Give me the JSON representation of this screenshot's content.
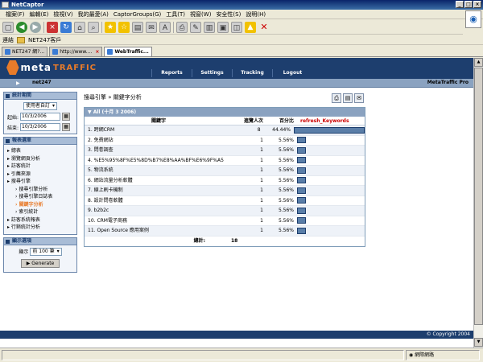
{
  "window": {
    "title": "NetCaptor"
  },
  "menubar": [
    "檔案(F)",
    "編輯(E)",
    "檢視(V)",
    "我的最愛(A)",
    "CaptorGroups(G)",
    "工具(T)",
    "視窗(W)",
    "安全性(S)",
    "說明(H)"
  ],
  "links": {
    "label": "連結",
    "folder": "NET247客戶"
  },
  "tabs": [
    {
      "label": "NET247 網?..."
    },
    {
      "label": "http://www...."
    },
    {
      "label": "WebTraffic..."
    }
  ],
  "app": {
    "logo_word1": "meta",
    "logo_word2": "TRAFFIC",
    "nav": [
      "Reports",
      "Settings",
      "Tracking",
      "Logout"
    ],
    "user": "net247",
    "product": "MetaTraffic Pro",
    "copyright": "© Copyright 2004"
  },
  "sidebar": {
    "date_section": "統計期間",
    "range_select": "使用者自訂",
    "start_label": "起始:",
    "start_value": "10/3/2006",
    "end_label": "結束:",
    "end_value": "10/3/2006",
    "report_section": "報表選單",
    "menu": [
      {
        "label": "總表",
        "level": 1
      },
      {
        "label": "瀏覽網頁分析",
        "level": 1
      },
      {
        "label": "訪客統計",
        "level": 1
      },
      {
        "label": "引薦來源",
        "level": 1
      },
      {
        "label": "搜尋引擎",
        "level": 1
      },
      {
        "label": "搜尋引擎分析",
        "level": 2
      },
      {
        "label": "搜尋引擎日誌表",
        "level": 2
      },
      {
        "label": "關鍵字分析",
        "level": 2
      },
      {
        "label": "索引統計",
        "level": 2
      },
      {
        "label": "訪客系統報表",
        "level": 1
      },
      {
        "label": "行銷統計分析",
        "level": 1
      }
    ],
    "display_section": "顯示選項",
    "display_label": "顯示",
    "display_select": "前 100 筆",
    "generate": "Generate"
  },
  "main": {
    "breadcrumb": "搜尋引擎 » 關鍵字分析",
    "panel_title": "All (十月 3 2006)",
    "col_keyword": "關鍵字",
    "col_visits": "進覽人次",
    "col_pct": "百分比",
    "refresh": "refresh_Keywords",
    "rows": [
      {
        "name": "1.  跨網CRM",
        "visits": "8",
        "pct": "44.44%",
        "value": 44.44
      },
      {
        "name": "2.  免費網站",
        "visits": "1",
        "pct": "5.56%",
        "value": 5.56
      },
      {
        "name": "3.  問卷調查",
        "visits": "1",
        "pct": "5.56%",
        "value": 5.56
      },
      {
        "name": "4.  %E5%95%8F%E5%8D%B7%E8%AA%BF%E6%9F%A5",
        "visits": "1",
        "pct": "5.56%",
        "value": 5.56
      },
      {
        "name": "5.  物流系統",
        "visits": "1",
        "pct": "5.56%",
        "value": 5.56
      },
      {
        "name": "6.  網站流量分析軟體",
        "visits": "1",
        "pct": "5.56%",
        "value": 5.56
      },
      {
        "name": "7.  線上刷卡機制",
        "visits": "1",
        "pct": "5.56%",
        "value": 5.56
      },
      {
        "name": "8.  設計問卷軟體",
        "visits": "1",
        "pct": "5.56%",
        "value": 5.56
      },
      {
        "name": "9.  b2b2c",
        "visits": "1",
        "pct": "5.56%",
        "value": 5.56
      },
      {
        "name": "10. CRM電子商務",
        "visits": "1",
        "pct": "5.56%",
        "value": 5.56
      },
      {
        "name": "11. Open Source 應用案例",
        "visits": "1",
        "pct": "5.56%",
        "value": 5.56
      }
    ],
    "total_label": "總計:",
    "total_value": "18"
  },
  "status": {
    "zone": "網際網路"
  },
  "colors": {
    "header": "#1d3e6e",
    "accent": "#e87b2a",
    "bar": "#5a7ea8"
  }
}
